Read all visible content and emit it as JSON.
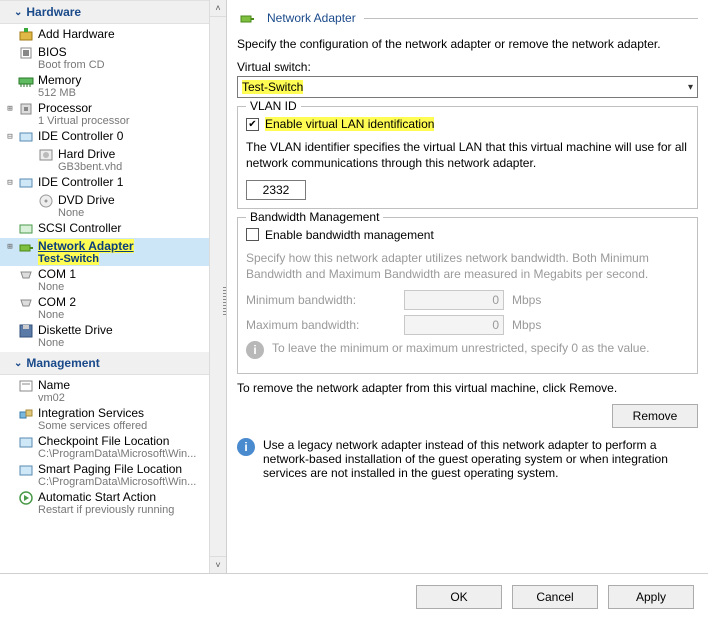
{
  "sections": {
    "hardware": "Hardware",
    "management": "Management"
  },
  "tree": {
    "add_hardware": "Add Hardware",
    "bios": {
      "label": "BIOS",
      "sub": "Boot from CD"
    },
    "memory": {
      "label": "Memory",
      "sub": "512 MB"
    },
    "processor": {
      "label": "Processor",
      "sub": "1 Virtual processor"
    },
    "ide0": {
      "label": "IDE Controller 0",
      "child": {
        "label": "Hard Drive",
        "sub": "GB3bent.vhd"
      }
    },
    "ide1": {
      "label": "IDE Controller 1",
      "child": {
        "label": "DVD Drive",
        "sub": "None"
      }
    },
    "scsi": "SCSI Controller",
    "network": {
      "label": "Network Adapter",
      "sub": "Test-Switch"
    },
    "com1": {
      "label": "COM 1",
      "sub": "None"
    },
    "com2": {
      "label": "COM 2",
      "sub": "None"
    },
    "diskette": {
      "label": "Diskette Drive",
      "sub": "None"
    },
    "name": {
      "label": "Name",
      "sub": "vm02"
    },
    "integration": {
      "label": "Integration Services",
      "sub": "Some services offered"
    },
    "checkpoint": {
      "label": "Checkpoint File Location",
      "sub": "C:\\ProgramData\\Microsoft\\Win..."
    },
    "smartpaging": {
      "label": "Smart Paging File Location",
      "sub": "C:\\ProgramData\\Microsoft\\Win..."
    },
    "autostart": {
      "label": "Automatic Start Action",
      "sub": "Restart if previously running"
    }
  },
  "right": {
    "title": "Network Adapter",
    "intro": "Specify the configuration of the network adapter or remove the network adapter.",
    "vswitch_label": "Virtual switch:",
    "vswitch_value": "Test-Switch",
    "vlan": {
      "legend": "VLAN ID",
      "enable": "Enable virtual LAN identification",
      "desc": "The VLAN identifier specifies the virtual LAN that this virtual machine will use for all network communications through this network adapter.",
      "value": "2332"
    },
    "bw": {
      "legend": "Bandwidth Management",
      "enable": "Enable bandwidth management",
      "hint": "Specify how this network adapter utilizes network bandwidth. Both Minimum Bandwidth and Maximum Bandwidth are measured in Megabits per second.",
      "min_label": "Minimum bandwidth:",
      "max_label": "Maximum bandwidth:",
      "min_val": "0",
      "max_val": "0",
      "unit": "Mbps",
      "zero_hint": "To leave the minimum or maximum unrestricted, specify 0 as the value."
    },
    "remove_hint": "To remove the network adapter from this virtual machine, click Remove.",
    "remove_btn": "Remove",
    "legacy_hint": "Use a legacy network adapter instead of this network adapter to perform a network-based installation of the guest operating system or when integration services are not installed in the guest operating system."
  },
  "footer": {
    "ok": "OK",
    "cancel": "Cancel",
    "apply": "Apply"
  }
}
